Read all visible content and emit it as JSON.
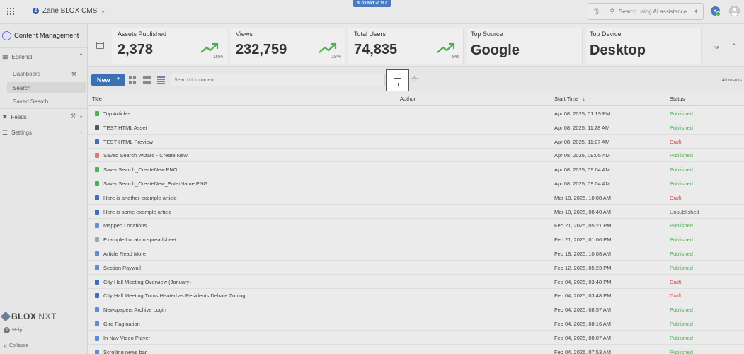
{
  "topbar": {
    "org_initial": "Z",
    "org_name": "Zane BLOX CMS",
    "version": "BLOX NXT v0.18.0",
    "ai_search_placeholder": "Search using AI assistance..."
  },
  "sidebar": {
    "title": "Content Management",
    "sections": [
      {
        "label": "Editorial",
        "expanded": true
      },
      {
        "label": "Feeds",
        "expanded": false
      },
      {
        "label": "Settings",
        "expanded": false
      }
    ],
    "editorial_items": [
      {
        "label": "Dashboard"
      },
      {
        "label": "Search",
        "active": true
      },
      {
        "label": "Saved Search"
      }
    ],
    "brand": {
      "blox": "BLOX",
      "nxt": "NXT"
    },
    "help": "Help",
    "collapse": "Collapse"
  },
  "stats": [
    {
      "label": "Assets Published",
      "value": "2,378",
      "pct": "10%"
    },
    {
      "label": "Views",
      "value": "232,759",
      "pct": "18%"
    },
    {
      "label": "Total Users",
      "value": "74,835",
      "pct": "9%"
    },
    {
      "label": "Top Source",
      "value": "Google"
    },
    {
      "label": "Top Device",
      "value": "Desktop"
    }
  ],
  "toolbar": {
    "new_label": "New",
    "search_placeholder": "Search for content...",
    "results": "40 results"
  },
  "table": {
    "columns": {
      "title": "Title",
      "author": "Author",
      "start_time": "Start Time",
      "status": "Status"
    },
    "rows": [
      {
        "title": "Top Articles",
        "start": "Apr 08, 2025, 01:19 PM",
        "status": "Published",
        "icon": "image-icon",
        "color": "#4caf50"
      },
      {
        "title": "TEST HTML Asset",
        "start": "Apr 08, 2025, 11:28 AM",
        "status": "Published",
        "icon": "html-icon",
        "color": "#555555"
      },
      {
        "title": "TEST HTML Preview",
        "start": "Apr 08, 2025, 11:27 AM",
        "status": "Draft",
        "icon": "article-icon",
        "color": "#3f6fb5"
      },
      {
        "title": "Saved Search Wizard - Create New",
        "start": "Apr 08, 2025, 09:05 AM",
        "status": "Published",
        "icon": "collection-icon",
        "color": "#e57373"
      },
      {
        "title": "SavedSearch_CreateNew.PNG",
        "start": "Apr 08, 2025, 09:04 AM",
        "status": "Published",
        "icon": "image-icon",
        "color": "#4caf50"
      },
      {
        "title": "SavedSearch_CreateNew_EnterName.PNG",
        "start": "Apr 08, 2025, 09:04 AM",
        "status": "Published",
        "icon": "image-icon",
        "color": "#4caf50"
      },
      {
        "title": "Here is another example article",
        "start": "Mar 18, 2025, 10:08 AM",
        "status": "Draft",
        "icon": "article-icon",
        "color": "#3f6fb5"
      },
      {
        "title": "Here is some example article",
        "start": "Mar 18, 2025, 08:40 AM",
        "status": "Unpublished",
        "icon": "article-icon",
        "color": "#3f6fb5"
      },
      {
        "title": "Mapped Locations",
        "start": "Feb 21, 2025, 05:21 PM",
        "status": "Published",
        "icon": "link-icon",
        "color": "#5c8fd6"
      },
      {
        "title": "Example Location spreadsheet",
        "start": "Feb 21, 2025, 01:06 PM",
        "status": "Published",
        "icon": "file-icon",
        "color": "#9aa7b8"
      },
      {
        "title": "Article Read More",
        "start": "Feb 18, 2025, 10:08 AM",
        "status": "Published",
        "icon": "link-icon",
        "color": "#5c8fd6"
      },
      {
        "title": "Section Paywall",
        "start": "Feb 12, 2025, 05:23 PM",
        "status": "Published",
        "icon": "link-icon",
        "color": "#5c8fd6"
      },
      {
        "title": "City Hall Meeting Overview (January)",
        "start": "Feb 04, 2025, 03:48 PM",
        "status": "Draft",
        "icon": "article-icon",
        "color": "#3f6fb5"
      },
      {
        "title": "City Hall Meeting Turns Heated as Residents Debate Zoning",
        "start": "Feb 04, 2025, 03:48 PM",
        "status": "Draft",
        "icon": "article-icon",
        "color": "#3f6fb5"
      },
      {
        "title": "Newspapers Archive Login",
        "start": "Feb 04, 2025, 08:57 AM",
        "status": "Published",
        "icon": "link-icon",
        "color": "#5c8fd6"
      },
      {
        "title": "Gird Pagination",
        "start": "Feb 04, 2025, 08:16 AM",
        "status": "Published",
        "icon": "link-icon",
        "color": "#5c8fd6"
      },
      {
        "title": "In Nav Video Player",
        "start": "Feb 04, 2025, 08:07 AM",
        "status": "Published",
        "icon": "link-icon",
        "color": "#5c8fd6"
      },
      {
        "title": "Scrolling news bar",
        "start": "Feb 04, 2025, 07:53 AM",
        "status": "Published",
        "icon": "link-icon",
        "color": "#5c8fd6"
      }
    ]
  },
  "colors": {
    "accent": "#3d6fb5",
    "published": "#4caf50",
    "draft": "#e53935",
    "trend": "#4caf50"
  }
}
